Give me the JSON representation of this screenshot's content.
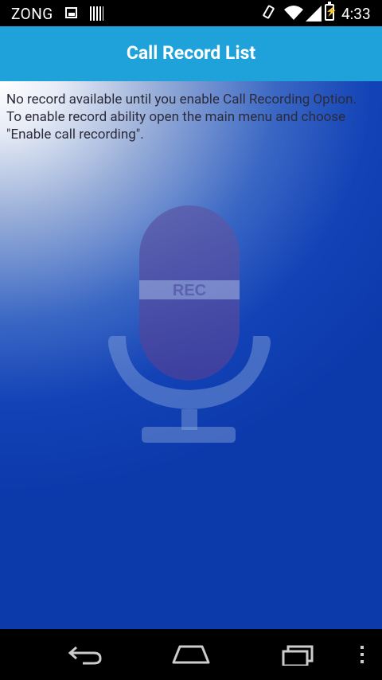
{
  "status_bar": {
    "carrier": "ZONG",
    "time": "4:33",
    "icons": [
      "image-icon",
      "barcode-icon",
      "vibrate-icon",
      "wifi-icon",
      "signal-icon",
      "battery-charging-icon"
    ]
  },
  "header": {
    "title": "Call Record List"
  },
  "main": {
    "message_lines": [
      "No record available until you enable Call Recording Option.",
      "To enable record ability open the main menu and choose \"Enable call recording\"."
    ],
    "illustration": {
      "icon": "microphone-icon",
      "label": "REC"
    }
  },
  "navigation": {
    "buttons": [
      "back-icon",
      "home-icon",
      "recents-icon",
      "overflow-menu-icon"
    ]
  },
  "colors": {
    "title_bar": "#1fa1d9",
    "background_bottom": "#0c3aab",
    "text": "#2b2b3b"
  }
}
